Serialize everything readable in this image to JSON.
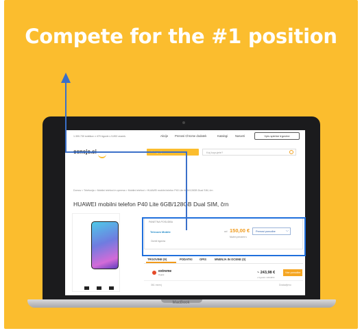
{
  "headline": "Compete for the #1 position",
  "laptop": {
    "brand": "MacBook"
  },
  "site": {
    "top_info": "1.300.730 izdelkov v 479 trgovin v 5.892 znamk.",
    "nav": [
      "Akcije",
      "Prenosi Chrome dodatek",
      "Katalogi",
      "Nasveti"
    ],
    "nav_button": "Vpis spletne trgovine",
    "logo": "ceneje.si",
    "categories_button": "Kategorije",
    "search_placeholder": "Kaj kupujete?",
    "breadcrumb": "Domov  >  Telefonija  >  Mobilni telefoni in oprema  >  Mobilni telefoni  >  HUAWEI mobilni telefon P40 Lite 6GB/128GB Dual SIM, črn",
    "product_title": "HUAWEI mobilni telefon P40 Lite 6GB/128GB Dual SIM, črn"
  },
  "offer": {
    "label": "PANETNA POSUDBA",
    "shop": "Telecom Mobile",
    "shop_sub": "Ocenil trgovino",
    "price_prefix": "od",
    "price": "150,00 €",
    "price_sub": "Možen prevzem v",
    "shops_dropdown": "Prenosi ponudbe",
    "dropdown_icon": "chevron-down-icon"
  },
  "tabs": [
    "TRGOVINE (9)",
    "PODATKI",
    "OPIS",
    "MNENJA IN OCENE (0)"
  ],
  "offer2": {
    "shop": "extreme",
    "shop_sub": "Digital",
    "price": "~ 243,98 €",
    "price_sub": "v trgovini: 243,98 €",
    "button": "Vse ponudbe",
    "row_left": "361 mnenj",
    "row_right": "Dostavljeno"
  },
  "colors": {
    "background": "#fbbd2e",
    "arrow": "#3a6fc9",
    "highlight": "#1f6fdc"
  }
}
